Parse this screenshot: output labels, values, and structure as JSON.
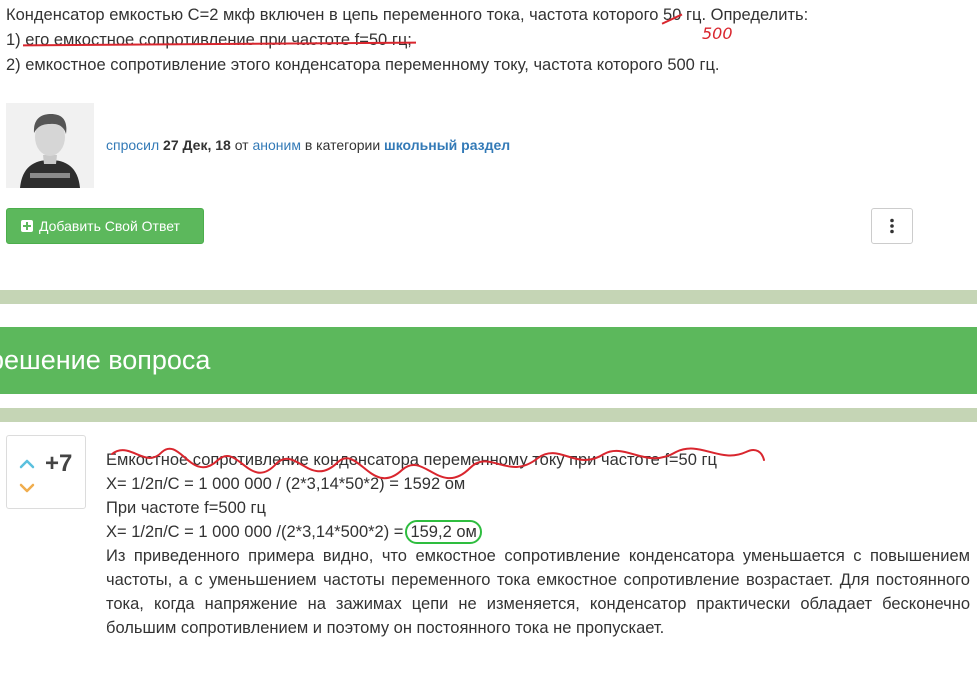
{
  "question": {
    "line1": "Конденсатор емкостью С=2 мкф включен в цепь переменного тока, частота которого ",
    "line1_freq": "50",
    "line1_end": " гц. Определить:",
    "handwritten_freq": "500",
    "item1_num": "1) ",
    "item1_text": "его емкостное сопротивление при частоте f=50 гц;",
    "item2": "2) емкостное сопротивление этого конденсатора переменному току, частота которого 500 гц."
  },
  "meta": {
    "asked": "спросил",
    "date": "27 Дек, 18",
    "from": "от",
    "author": "аноним",
    "in_category": "в категории",
    "category": "школьный раздел"
  },
  "buttons": {
    "add_answer": "Добавить Свой Ответ",
    "more_icon": "vertical-ellipsis-icon"
  },
  "banner": {
    "title": "решение вопроса"
  },
  "answer": {
    "votes": "+7",
    "lines": [
      "Емкостное сопротивление конденсатора переменному току при частоте f=50 гц",
      "X= 1/2п/С = 1 000 000 / (2*3,14*50*2) = 1592 ом",
      "При частоте f=500 гц",
      "X= 1/2п/С = 1 000 000 /(2*3,14*500*2) ="
    ],
    "result": "159,2 ом",
    "paragraph": "Из приведенного примера видно, что емкостное сопротивление конденсатора уменьшается с повышением частоты, а с уменьшением частоты переменного тока емкостное сопротивление возрастает. Для постоянного тока, когда напряжение на зажимах цепи не изменяется, конденсатор практически обладает бесконечно большим сопротивлением и поэтому он постоянного тока не пропускает."
  },
  "colors": {
    "green": "#5cb85c",
    "stripe": "#c5d5b5",
    "link": "#337ab7",
    "annotation_red": "#d9262e",
    "annotation_green": "#2ebd3f",
    "vote_up": "#5bc0de",
    "vote_down": "#f0ad4e"
  }
}
